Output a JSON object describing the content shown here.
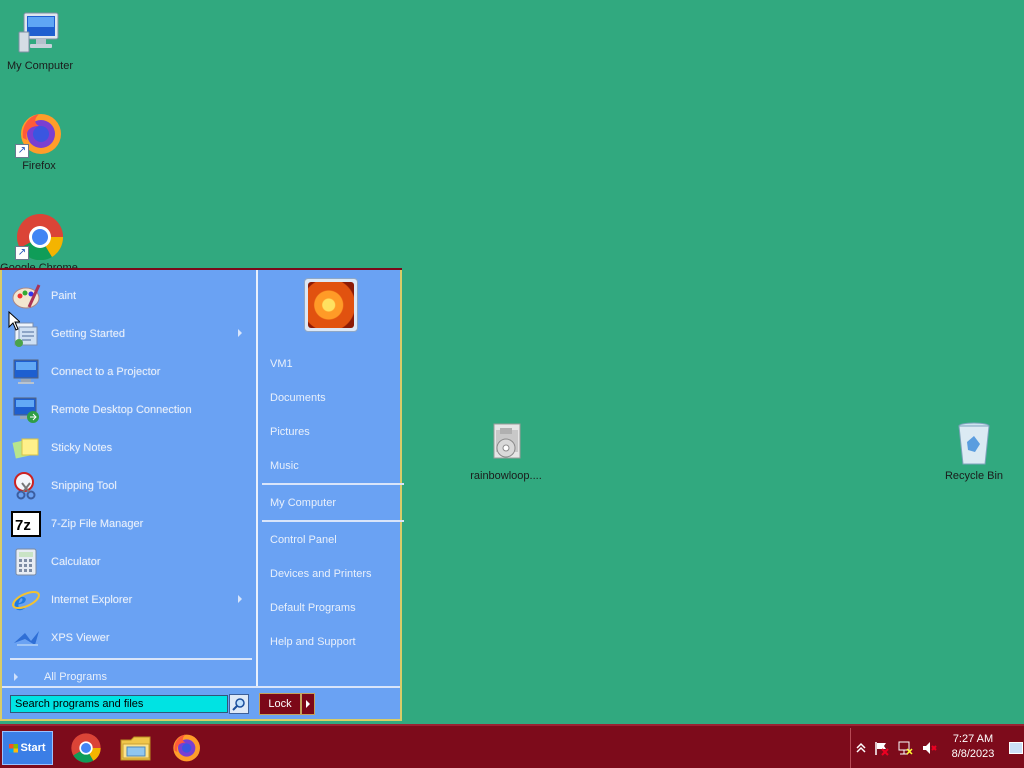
{
  "desktop": {
    "icons": [
      {
        "label": "My Computer"
      },
      {
        "label": "Firefox"
      },
      {
        "label": "Google Chrome"
      },
      {
        "label": "rainbowloop...."
      },
      {
        "label": "Recycle Bin"
      }
    ]
  },
  "start_menu": {
    "programs": [
      {
        "label": "Paint",
        "icon": "paint-icon"
      },
      {
        "label": "Getting Started",
        "icon": "getting-started-icon",
        "submenu": true
      },
      {
        "label": "Connect to a Projector",
        "icon": "projector-icon"
      },
      {
        "label": "Remote Desktop Connection",
        "icon": "remote-desktop-icon"
      },
      {
        "label": "Sticky Notes",
        "icon": "sticky-notes-icon"
      },
      {
        "label": "Snipping Tool",
        "icon": "snipping-tool-icon"
      },
      {
        "label": "7-Zip File Manager",
        "icon": "7zip-icon"
      },
      {
        "label": "Calculator",
        "icon": "calculator-icon"
      },
      {
        "label": "Internet Explorer",
        "icon": "internet-explorer-icon",
        "submenu": true
      },
      {
        "label": "XPS Viewer",
        "icon": "xps-viewer-icon"
      }
    ],
    "all_programs": "All Programs",
    "right_links": {
      "user": "VM1",
      "documents": "Documents",
      "pictures": "Pictures",
      "music": "Music",
      "computer": "My Computer",
      "control_panel": "Control Panel",
      "devices": "Devices and Printers",
      "default_programs": "Default Programs",
      "help": "Help and Support"
    },
    "search_placeholder": "Search programs and files",
    "lock_label": "Lock"
  },
  "taskbar": {
    "start_label": "Start",
    "pinned": [
      "chrome-icon",
      "file-explorer-icon",
      "firefox-icon"
    ],
    "clock_time": "7:27 AM",
    "clock_date": "8/8/2023"
  },
  "colors": {
    "desktop": "#31a97f",
    "start_menu": "#6aa2f3",
    "taskbar": "#7d0b1b",
    "search_field": "#00e3e3"
  }
}
